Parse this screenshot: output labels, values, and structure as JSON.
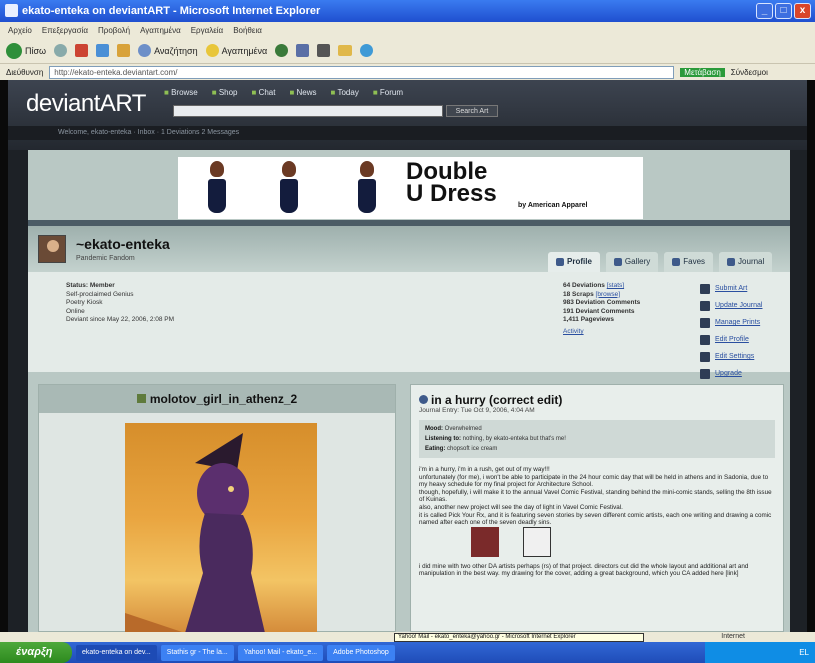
{
  "window": {
    "title": "ekato-enteka on deviantART - Microsoft Internet Explorer",
    "controls": [
      "_",
      "□",
      "x"
    ]
  },
  "menubar": [
    "Αρχείο",
    "Επεξεργασία",
    "Προβολή",
    "Αγαπημένα",
    "Εργαλεία",
    "Βοήθεια"
  ],
  "toolbar": {
    "back": "Πίσω",
    "search": "Αναζήτηση",
    "favorites": "Αγαπημένα"
  },
  "address": {
    "label": "Διεύθυνση",
    "url": "http://ekato-enteka.deviantart.com/",
    "go": "Μετάβαση",
    "links": "Σύνδεσμοι"
  },
  "da": {
    "logo": "deviantART",
    "nav": [
      "Browse",
      "Shop",
      "Chat",
      "News",
      "Today",
      "Forum"
    ],
    "search_button": "Search Art",
    "subnav": "Welcome, ekato-enteka  ·  Inbox  ·  1 Deviations  2 Messages"
  },
  "ad": {
    "headline_1": "Double",
    "headline_2": "U Dress",
    "byline": "by American Apparel"
  },
  "profile": {
    "username": "~ekato-enteka",
    "subtitle": "Pandemic Fandom",
    "tabs": [
      "Profile",
      "Gallery",
      "Faves",
      "Journal"
    ],
    "status": {
      "status_label": "Status: Member",
      "line1": "Self-proclaimed Genius",
      "line2": "Poetry Kiosk",
      "line3": "Online",
      "since": "Deviant since May 22, 2006, 2:08 PM"
    },
    "stats": {
      "deviations": "64 Deviations",
      "stats_link": "[stats]",
      "scraps": "18 Scraps",
      "browse_link": "[browse]",
      "dev_comments": "983 Deviation Comments",
      "deviant_comments": "191 Deviant Comments",
      "pageviews": "1,411 Pageviews",
      "activity": "Activity"
    },
    "actions": [
      "Submit Art",
      "Update Journal",
      "Manage Prints",
      "Edit Profile",
      "Edit Settings",
      "Upgrade"
    ]
  },
  "deviation": {
    "title": "molotov_girl_in_athenz_2"
  },
  "journal": {
    "title": "in a hurry (correct edit)",
    "date": "Journal Entry: Tue Oct 9, 2006, 4:04 AM",
    "mood_label": "Mood:",
    "mood": "Overwhelmed",
    "listening_label": "Listening to:",
    "listening": "nothing, by ekato-enteka but that's me!",
    "reading_label": "Eating:",
    "reading": "chopsoft ice cream",
    "para1": "i'm in a hurry, i'm in a rush, get out of my way!!!",
    "para2": "unfortunately (for me), i won't be able to participate in the 24 hour comic day that will be held in athens and in Sadonia, due to my heavy schedule for my final project for Architecture School.",
    "para3": "though, hopefully, i will make it to the annual Vavel Comic Festival, standing behind the mini-comic stands, selling the 8th issue of Kuinas.",
    "para4": "also, another new project will see the day of light in Vavel Comic Festival.",
    "para5": "it is called Pick Your Rx, and it is featuring seven stories by seven different comic artists, each one writing and drawing a comic named after each one of the seven deadly sins.",
    "para6": "i did mine with two other DA artists perhaps (rs) of that project. directors cut did the whole layout and additional art and manipulation in the best way. my drawing for the cover, adding a great background, which you CA added here [link]"
  },
  "statusbar": {
    "text": "",
    "zone": "Internet",
    "tooltip": "Yahoo! Mail - ekato_enteka@yahoo.gr - Microsoft Internet Explorer"
  },
  "taskbar": {
    "start": "έναρξη",
    "tasks": [
      "ekato-enteka on dev...",
      "Stathis gr - The la...",
      "Yahoo! Mail - ekato_e...",
      "Adobe Photoshop"
    ],
    "tray": "EL"
  }
}
